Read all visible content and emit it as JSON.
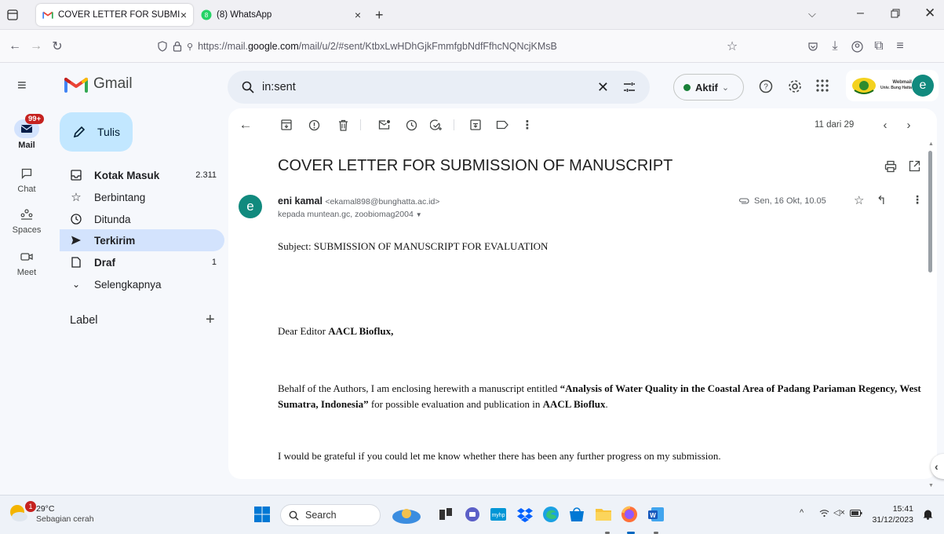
{
  "browser": {
    "tabs": [
      {
        "title": "COVER LETTER FOR SUBMISSIO",
        "favicon": "gmail-icon",
        "active": true
      },
      {
        "title": "(8) WhatsApp",
        "favicon": "whatsapp-icon",
        "active": false
      }
    ],
    "url_prefix": "https://mail.",
    "url_domain": "google.com",
    "url_rest": "/mail/u/2/#sent/KtbxLwHDhGjkFmmfgbNdfFfhcNQNcjKMsB"
  },
  "gmail": {
    "logo_text": "Gmail",
    "compose_label": "Tulis",
    "rail": [
      {
        "label": "Mail",
        "icon": "mail-icon",
        "badge": "99+"
      },
      {
        "label": "Chat",
        "icon": "chat-icon"
      },
      {
        "label": "Spaces",
        "icon": "spaces-icon"
      },
      {
        "label": "Meet",
        "icon": "meet-icon"
      }
    ],
    "nav": [
      {
        "label": "Kotak Masuk",
        "count": "2.311",
        "icon": "inbox-icon",
        "bold": true
      },
      {
        "label": "Berbintang",
        "count": "",
        "icon": "star-icon"
      },
      {
        "label": "Ditunda",
        "count": "",
        "icon": "clock-icon"
      },
      {
        "label": "Terkirim",
        "count": "",
        "icon": "send-icon",
        "selected": true
      },
      {
        "label": "Draf",
        "count": "1",
        "icon": "draft-icon",
        "bold": true
      },
      {
        "label": "Selengkapnya",
        "count": "",
        "icon": "chevron-down-icon"
      }
    ],
    "labels_heading": "Label",
    "search_value": "in:sent",
    "status": "Aktif",
    "org_badge_line1": "Webmail",
    "org_badge_line2": "Univ. Bung Hatta",
    "avatar_letter": "e",
    "pagination": "11 dari 29"
  },
  "email": {
    "subject": "COVER LETTER FOR SUBMISSION OF MANUSCRIPT",
    "sender_name": "eni kamal",
    "sender_email": "<ekamal898@bunghatta.ac.id>",
    "recipients": "kepada muntean.gc, zoobiomag2004",
    "date": "Sen, 16 Okt, 10.05",
    "avatar_letter": "e",
    "body": {
      "subject_line": "Subject: SUBMISSION OF MANUSCRIPT FOR EVALUATION",
      "greeting_prefix": "Dear Editor ",
      "greeting_bold": "AACL Bioflux,",
      "p1_a": "Behalf of the Authors, I am enclosing herewith a manuscript entitled ",
      "p1_title": "“Analysis of Water Quality in the Coastal Area of Padang Pariaman Regency, West Sumatra, Indonesia”",
      "p1_b": " for possible evaluation and publication in ",
      "p1_journal": "AACL Bioflux",
      "p1_end": ".",
      "p2": "I would be grateful if you could let me know whether there has been any further progress on my submission."
    }
  },
  "taskbar": {
    "temperature": "29°C",
    "weather": "Sebagian cerah",
    "weather_badge": "1",
    "search_placeholder": "Search",
    "time": "15:41",
    "date": "31/12/2023"
  }
}
